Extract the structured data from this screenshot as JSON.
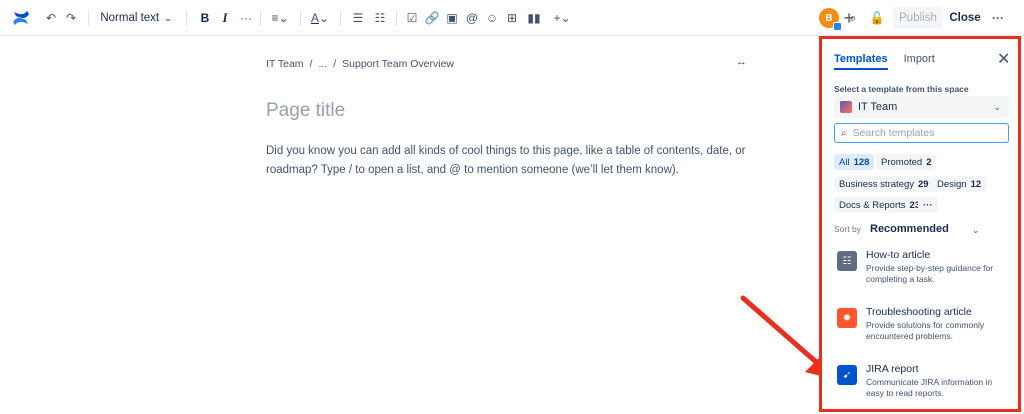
{
  "toolbar": {
    "text_style": "Normal text",
    "bold": "B",
    "italic": "I",
    "more": "···",
    "avatar_initial": "B",
    "add": "+",
    "publish": "Publish",
    "close": "Close",
    "menu_more": "···"
  },
  "editor": {
    "breadcrumb": [
      "IT Team",
      "/",
      "...",
      "/",
      "Support Team Overview"
    ],
    "title_placeholder": "Page title",
    "body_placeholder": "Did you know you can add all kinds of cool things to this page, like a table of contents, date, or roadmap? Type / to open a list, and @ to mention someone (we’ll let them know)."
  },
  "panel": {
    "tabs": [
      "Templates",
      "Import"
    ],
    "select_label": "Select a template from this space",
    "space": "IT Team",
    "search_placeholder": "Search templates",
    "chips": [
      {
        "label": "All",
        "count": "128",
        "selected": true
      },
      {
        "label": "Promoted",
        "count": "2"
      },
      {
        "label": "Business strategy",
        "count": "29"
      },
      {
        "label": "Design",
        "count": "12"
      },
      {
        "label": "Docs & Reports",
        "count": "23"
      },
      {
        "label": "···",
        "count": ""
      }
    ],
    "sort_label": "Sort by",
    "sort_value": "Recommended",
    "templates": [
      {
        "name": "How-to article",
        "desc": "Provide step-by-step guidance for completing a task.",
        "color": "#5e6c84",
        "icon": "list-icon"
      },
      {
        "name": "Troubleshooting article",
        "desc": "Provide solutions for commonly encountered problems.",
        "color": "#ff5630",
        "icon": "bug-icon"
      },
      {
        "name": "JIRA report",
        "desc": "Communicate JIRA information in easy to read reports.",
        "color": "#0052cc",
        "icon": "jira-icon"
      }
    ]
  },
  "colors": {
    "accent": "#0052cc",
    "highlight": "#e8301c"
  }
}
